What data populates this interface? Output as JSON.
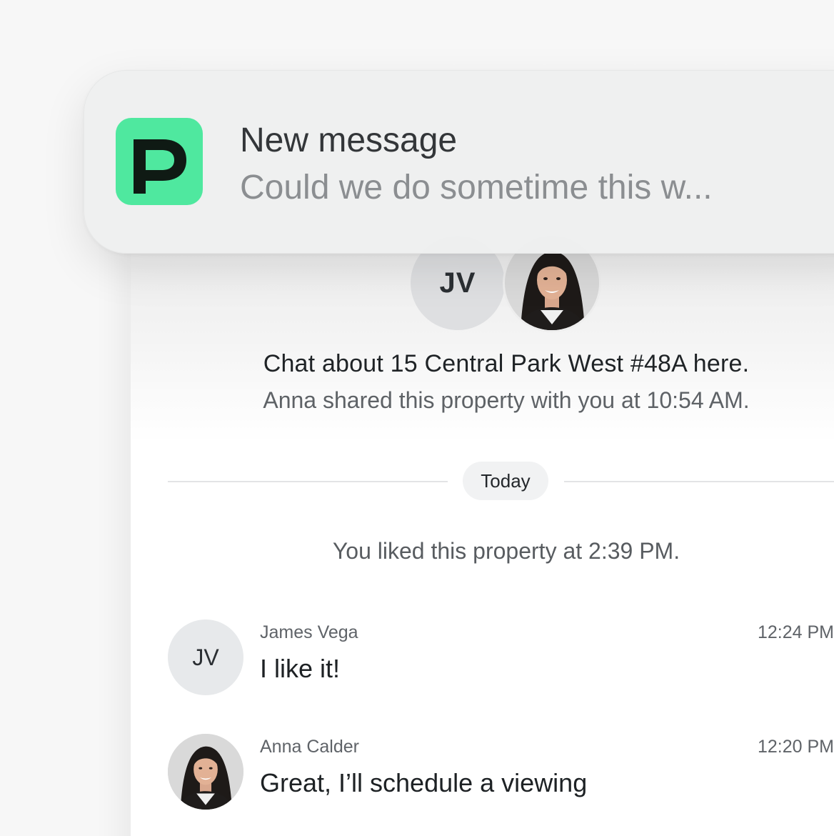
{
  "notification": {
    "title": "New message",
    "body": "Could we do sometime this w...",
    "app_icon": "app-logo-p-icon",
    "accent_color": "#4fe89f"
  },
  "chat": {
    "participants": {
      "initials": "JV",
      "photo": "agent-photo"
    },
    "intro_title": "Chat about 15 Central Park West #48A here.",
    "intro_subtitle": "Anna shared this property with you at 10:54 AM.",
    "divider_label": "Today",
    "liked_note": "You liked this property at 2:39 PM.",
    "messages": [
      {
        "avatar_initials": "JV",
        "sender": "James Vega",
        "time": "12:24 PM",
        "text": "I like it!"
      },
      {
        "avatar_photo": "agent-photo",
        "sender": "Anna Calder",
        "time": "12:20 PM",
        "text": "Great, I’ll schedule a viewing"
      }
    ]
  }
}
